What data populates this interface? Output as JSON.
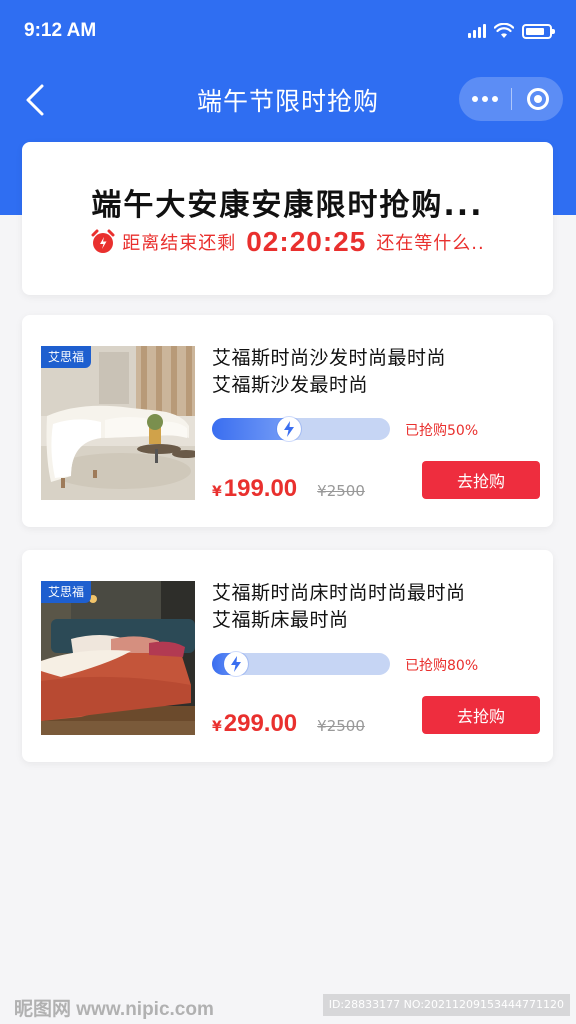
{
  "status_bar": {
    "time": "9:12 AM"
  },
  "nav": {
    "title": "端午节限时抢购"
  },
  "promo": {
    "title": "端午大安康安康限时抢购...",
    "countdown_label": "距离结束还剩",
    "countdown_time": "02:20:25",
    "countdown_tail": "还在等什么.."
  },
  "products": [
    {
      "brand": "艾思福",
      "name_line1": "艾福斯时尚沙发时尚最时尚",
      "name_line2": "艾福斯沙发最时尚",
      "progress_fraction": 0.5,
      "progress_text": "已抢购50%",
      "currency": "¥",
      "price": "199.00",
      "old_price": "¥2500",
      "buy_label": "去抢购"
    },
    {
      "brand": "艾思福",
      "name_line1": "艾福斯时尚床时尚时尚最时尚",
      "name_line2": "艾福斯床最时尚",
      "progress_fraction": 0.2,
      "progress_text": "已抢购80%",
      "currency": "¥",
      "price": "299.00",
      "old_price": "¥2500",
      "buy_label": "去抢购"
    }
  ],
  "watermark": {
    "site": "昵图网 www.nipic.com",
    "id_text": "ID:28833177 NO:20211209153444771120"
  },
  "colors": {
    "primary_blue": "#2f6ef2",
    "accent_red": "#ee2d3e",
    "price_red": "#e9302e"
  }
}
